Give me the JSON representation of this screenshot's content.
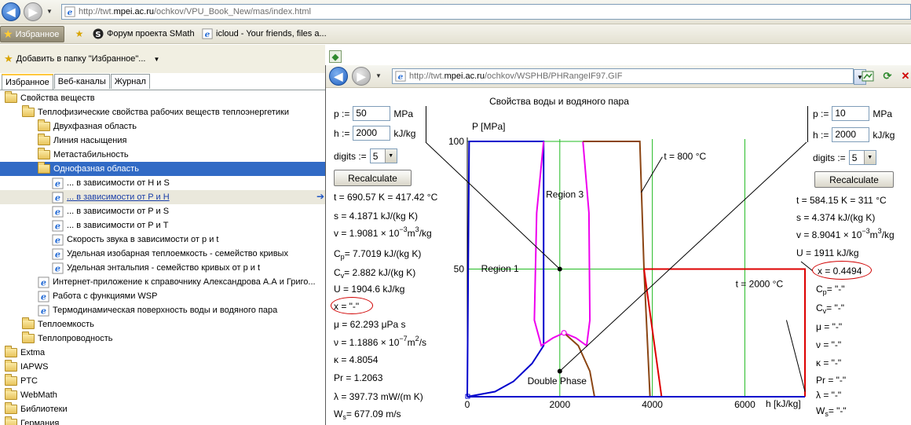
{
  "outer_browser": {
    "address": {
      "prefix": "http://twt.",
      "domain": "mpei.ac.ru",
      "path": "/ochkov/VPU_Book_New/mas/index.html"
    },
    "favorites_button": "Избранное",
    "links": [
      {
        "icon": "smath-logo-icon",
        "label": "Форум проекта SMath"
      },
      {
        "icon": "ie-page-icon",
        "label": "icloud - Your friends, files a..."
      }
    ]
  },
  "favorites_pane": {
    "add_label": "Добавить в папку \"Избранное\"...",
    "tabs": [
      "Избранное",
      "Веб-каналы",
      "Журнал"
    ],
    "items": [
      {
        "type": "folder",
        "label": "Свойства веществ",
        "indent": 0
      },
      {
        "type": "folder",
        "label": "Теплофизические свойства рабочих веществ теплоэнергетики",
        "indent": 1
      },
      {
        "type": "folder",
        "label": "Двухфазная область",
        "indent": 2
      },
      {
        "type": "folder",
        "label": "Линия насыщения",
        "indent": 2
      },
      {
        "type": "folder",
        "label": "Метастабильность",
        "indent": 2
      },
      {
        "type": "folder-open",
        "label": "Однофазная область",
        "indent": 2,
        "state": "selected"
      },
      {
        "type": "link",
        "label": "... в зависимости от H и S",
        "indent": 3
      },
      {
        "type": "link",
        "label": "... в зависимости от P и H",
        "indent": 3,
        "state": "hover"
      },
      {
        "type": "link",
        "label": "... в зависимости от P и S",
        "indent": 3
      },
      {
        "type": "link",
        "label": "... в зависимости от P и T",
        "indent": 3
      },
      {
        "type": "link",
        "label": "Скорость звука в зависимости от p и t",
        "indent": 3
      },
      {
        "type": "link",
        "label": "Удельная изобарная теплоемкость - семейство кривых",
        "indent": 3
      },
      {
        "type": "link",
        "label": "Удельная энтальпия - семейство кривых от p и t",
        "indent": 3
      },
      {
        "type": "link",
        "label": "Интернет-приложение к справочнику  Александрова А.А и Григо...",
        "indent": 2
      },
      {
        "type": "link",
        "label": "Работа с функциями WSP",
        "indent": 2
      },
      {
        "type": "link",
        "label": "Термодинамическая поверхность воды и водяного пара",
        "indent": 2
      },
      {
        "type": "folder",
        "label": "Теплоемкость",
        "indent": 1
      },
      {
        "type": "folder",
        "label": "Теплопроводность",
        "indent": 1
      },
      {
        "type": "folder",
        "label": "Extma",
        "indent": 0
      },
      {
        "type": "folder",
        "label": "IAPWS",
        "indent": 0
      },
      {
        "type": "folder",
        "label": "PTC",
        "indent": 0
      },
      {
        "type": "folder",
        "label": "WebMath",
        "indent": 0
      },
      {
        "type": "folder",
        "label": "Библиотеки",
        "indent": 0
      },
      {
        "type": "folder",
        "label": "Германия",
        "indent": 0
      }
    ]
  },
  "inner_browser": {
    "address": {
      "prefix": "http://twt.",
      "domain": "mpei.ac.ru",
      "path": "/ochkov/WSPHB/PHRangeIF97.GIF"
    }
  },
  "left_panel": {
    "p_label": "p :=",
    "p_value": "50",
    "p_unit": "MPa",
    "h_label": "h :=",
    "h_value": "2000",
    "h_unit": "kJ/kg",
    "digits_label": "digits :=",
    "digits_value": "5",
    "recalc": "Recalculate",
    "results": {
      "t": "t = 690.57 K = 417.42 °C",
      "s": "s = 4.1871 kJ/(kg K)",
      "v_pre": "v = 1.9081 × 10",
      "v_exp": "−3",
      "v_post": " m",
      "v_exp2": "3",
      "v_post2": "/kg",
      "cp_sym": "C",
      "cp_sub": "p",
      "cp_val": " = 7.7019 kJ/(kg K)",
      "cv_sym": "C",
      "cv_sub": "v",
      "cv_val": " = 2.882 kJ/(kg K)",
      "U": "U = 1904.6 kJ/kg",
      "x": "x = \"-\"",
      "mu": "μ = 62.293 μPa s",
      "nu_pre": "ν = 1.1886 × 10",
      "nu_exp": "−7",
      "nu_post": " m",
      "nu_exp2": "2",
      "nu_post2": "/s",
      "kappa": "κ = 4.8054",
      "Pr": "Pr = 1.2063",
      "lambda": "λ = 397.73 mW/(m K)",
      "ws_sym": "W",
      "ws_sub": "s",
      "ws_val": " = 677.09 m/s"
    }
  },
  "right_panel": {
    "p_label": "p :=",
    "p_value": "10",
    "p_unit": "MPa",
    "h_label": "h :=",
    "h_value": "2000",
    "h_unit": "kJ/kg",
    "digits_label": "digits :=",
    "digits_value": "5",
    "recalc": "Recalculate",
    "results": {
      "t": "t = 584.15 K = 311 °C",
      "s": "s = 4.374 kJ/(kg K)",
      "v_pre": "v = 8.9041 × 10",
      "v_exp": "−3",
      "v_post": " m",
      "v_exp2": "3",
      "v_post2": "/kg",
      "U": "U = 1911 kJ/kg",
      "x": "x = 0.4494",
      "cp_sym": "C",
      "cp_sub": "p",
      "cp_val": " = \"-\"",
      "cv_sym": "C",
      "cv_sub": "v",
      "cv_val": " = \"-\"",
      "mu": "μ = \"-\"",
      "nu": "ν = \"-\"",
      "kappa": "κ = \"-\"",
      "Pr": "Pr = \"-\"",
      "lambda": "λ = \"-\"",
      "ws_sym": "W",
      "ws_sub": "s",
      "ws_val": " = \"-\""
    }
  },
  "chart_data": {
    "type": "line",
    "title": "Свойства воды и водяного пара",
    "xlabel": "h [kJ/kg]",
    "ylabel": "P [MPa]",
    "xlim": [
      0,
      7000
    ],
    "ylim": [
      0,
      100
    ],
    "x_ticks": [
      "0",
      "2000",
      "4000",
      "6000"
    ],
    "y_ticks": [
      "100",
      "50"
    ],
    "annotations": [
      "Region 3",
      "Region 1",
      "Double Phase",
      "t = 800 °C",
      "t = 2000 °C"
    ],
    "state_points": [
      {
        "p": 50,
        "h": 2000
      },
      {
        "p": 10,
        "h": 2000
      }
    ],
    "series": [
      {
        "color": "#0000cc",
        "points": [
          [
            0,
            0
          ],
          [
            40,
            100
          ],
          [
            1650,
            100
          ],
          [
            1650,
            20
          ],
          [
            1400,
            13
          ],
          [
            1000,
            6
          ],
          [
            600,
            2
          ],
          [
            0,
            0
          ]
        ]
      },
      {
        "color": "#ee00ee",
        "points": [
          [
            1650,
            100
          ],
          [
            1500,
            72
          ],
          [
            1450,
            30
          ],
          [
            1600,
            20
          ],
          [
            1850,
            23
          ],
          [
            2090,
            25
          ],
          [
            2350,
            23
          ],
          [
            2580,
            20
          ],
          [
            2650,
            30
          ],
          [
            2630,
            72
          ],
          [
            2500,
            100
          ]
        ]
      },
      {
        "color": "#8b4513",
        "points": [
          [
            2500,
            100
          ],
          [
            3730,
            100
          ],
          [
            3820,
            50
          ],
          [
            3950,
            0
          ]
        ]
      },
      {
        "color": "#8b4513",
        "points": [
          [
            2090,
            25
          ],
          [
            2400,
            20
          ],
          [
            2650,
            10
          ],
          [
            2750,
            0
          ]
        ]
      },
      {
        "color": "#dd0000",
        "points": [
          [
            3820,
            50
          ],
          [
            7300,
            50
          ],
          [
            7300,
            0
          ]
        ]
      },
      {
        "color": "#dd0000",
        "points": [
          [
            3820,
            50
          ],
          [
            4200,
            0
          ]
        ]
      },
      {
        "color": "#0000cc",
        "points": [
          [
            0,
            0
          ],
          [
            7300,
            0
          ]
        ]
      }
    ]
  }
}
